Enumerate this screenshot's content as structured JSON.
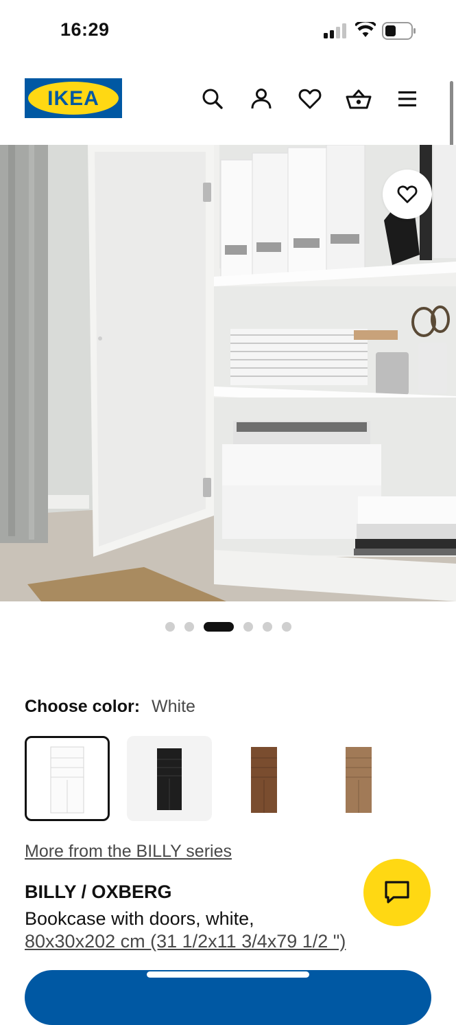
{
  "status": {
    "time": "16:29"
  },
  "header": {
    "logo_text": "IKEA",
    "icons": [
      "search-icon",
      "account-icon",
      "heart-icon",
      "basket-icon",
      "menu-icon"
    ]
  },
  "gallery": {
    "dot_count": 6,
    "active_index": 2
  },
  "color": {
    "label": "Choose color:",
    "value": "White",
    "swatches": [
      {
        "name": "White",
        "selected": true
      },
      {
        "name": "Black-brown",
        "selected": false
      },
      {
        "name": "Brown walnut",
        "selected": false
      },
      {
        "name": "Oak effect",
        "selected": false
      }
    ]
  },
  "series_link": "More from the BILLY series",
  "product": {
    "name": "BILLY / OXBERG",
    "description": "Bookcase with doors, white,",
    "dimensions": "80x30x202 cm (31 1/2x11 3/4x79 1/2 \")"
  },
  "colors": {
    "brand_blue": "#0058a3",
    "brand_yellow": "#ffd813"
  }
}
